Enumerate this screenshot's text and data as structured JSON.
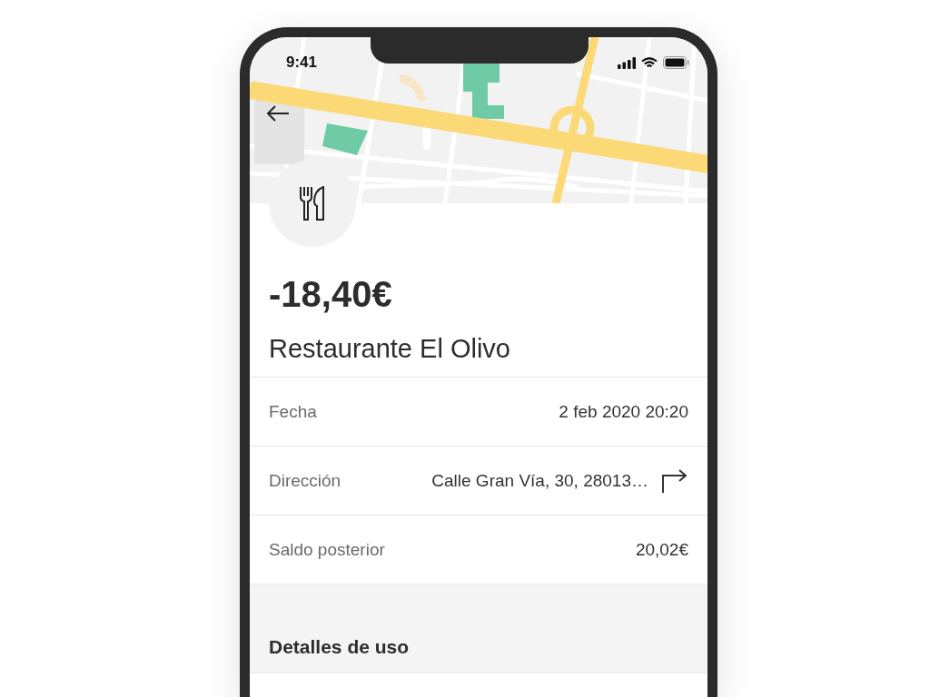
{
  "status_bar": {
    "time": "9:41"
  },
  "transaction": {
    "amount": "-18,40€",
    "merchant": "Restaurante El Olivo"
  },
  "details": [
    {
      "kind": "text",
      "label": "Fecha",
      "value": "2 feb 2020 20:20"
    },
    {
      "kind": "link",
      "label": "Dirección",
      "value": "Calle Gran Vía, 30, 28013…"
    },
    {
      "kind": "text",
      "label": "Saldo posterior",
      "value": "20,02€"
    }
  ],
  "section": {
    "title": "Detalles de uso"
  }
}
